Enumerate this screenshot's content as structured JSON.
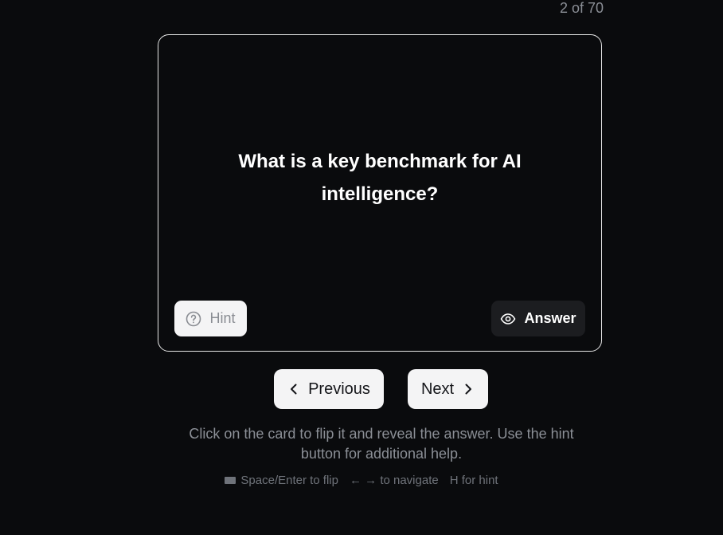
{
  "progress": {
    "text": "2 of 70",
    "current": 2,
    "total": 70
  },
  "card": {
    "question": "What is a key benchmark for AI intelligence?",
    "hint_label": "Hint",
    "hint_icon": "question-circle-icon",
    "answer_label": "Answer",
    "answer_icon": "eye-icon"
  },
  "navigation": {
    "previous_label": "Previous",
    "previous_icon": "chevron-left-icon",
    "next_label": "Next",
    "next_icon": "chevron-right-icon"
  },
  "instructions": {
    "text": "Click on the card to flip it and reveal the answer. Use the hint button for additional help.",
    "shortcuts": [
      {
        "icon": "keyboard-icon",
        "label": "Space/Enter to flip"
      },
      {
        "label": "← → to navigate"
      },
      {
        "label": "H for hint"
      }
    ]
  },
  "colors": {
    "background": "#0a0b0d",
    "card_border": "#e6e6e6",
    "light_button": "#f4f4f5",
    "dark_button": "#1c1d20",
    "muted_text": "#8b8f96"
  }
}
